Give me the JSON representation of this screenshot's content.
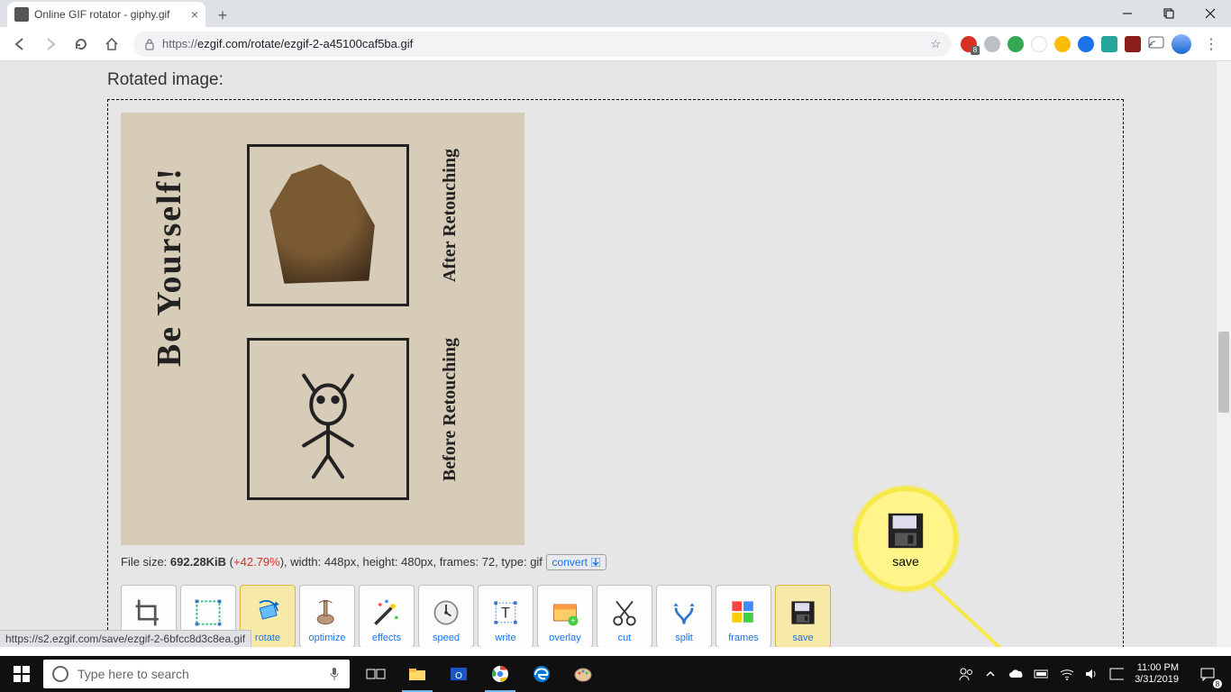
{
  "browser": {
    "tab_title": "Online GIF rotator - giphy.gif",
    "url_host": "https://",
    "url_rest": "ezgif.com/rotate/ezgif-2-a45100caf5ba.gif",
    "status_url": "https://s2.ezgif.com/save/ezgif-2-6bfcc8d3c8ea.gif"
  },
  "page": {
    "heading": "Rotated image:",
    "gif": {
      "headline": "Be Yourself!",
      "label_after": "After Retouching",
      "label_before": "Before Retouching"
    },
    "fileinfo": {
      "prefix": "File size: ",
      "size": "692.28KiB",
      "pct": "+42.79%",
      "rest": "), width: 448px, height: 480px, frames: 72, type: gif",
      "convert": "convert"
    },
    "actions": [
      "crop",
      "resize",
      "rotate",
      "optimize",
      "effects",
      "speed",
      "write",
      "overlay",
      "cut",
      "split",
      "frames",
      "save"
    ],
    "callout_label": "save"
  },
  "taskbar": {
    "search_placeholder": "Type here to search",
    "time": "11:00 PM",
    "date": "3/31/2019"
  }
}
